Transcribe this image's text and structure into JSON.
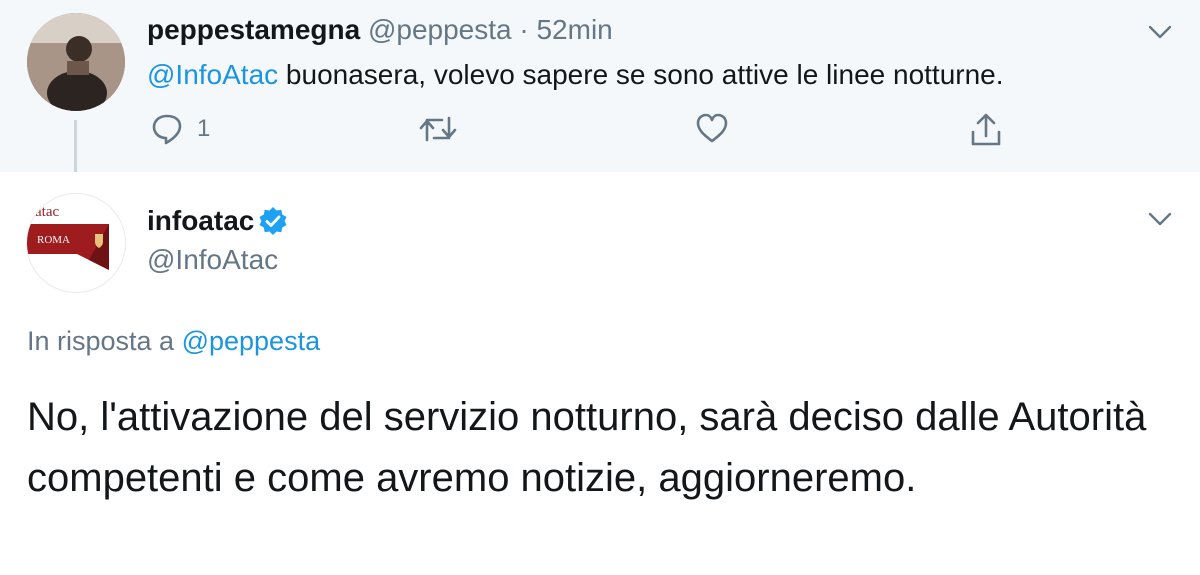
{
  "parent_tweet": {
    "display_name": "peppestamegna",
    "handle": "@peppesta",
    "separator": "·",
    "time": "52min",
    "mention": "@InfoAtac",
    "text": " buonasera, volevo sapere se sono attive le linee notturne.",
    "reply_count": "1",
    "icons": [
      "reply-icon",
      "retweet-icon",
      "like-icon",
      "share-icon",
      "chevron-down-icon"
    ]
  },
  "main_tweet": {
    "display_name": "infoatac",
    "verified": true,
    "handle": "@InfoAtac",
    "avatar_logo": {
      "top": "atac",
      "bottom": "ROMA"
    },
    "reply_prefix": "In risposta a ",
    "reply_to": "@peppesta",
    "text": "No,  l'attivazione del servizio notturno, sarà deciso dalle Autorità competenti e come avremo notizie, aggiorneremo."
  },
  "colors": {
    "accent": "#1b95e0",
    "verified": "#1da1f2",
    "muted": "#657786",
    "text": "#14171a",
    "parent_bg": "#f5f8fa",
    "logo_red": "#9e1b1e"
  }
}
